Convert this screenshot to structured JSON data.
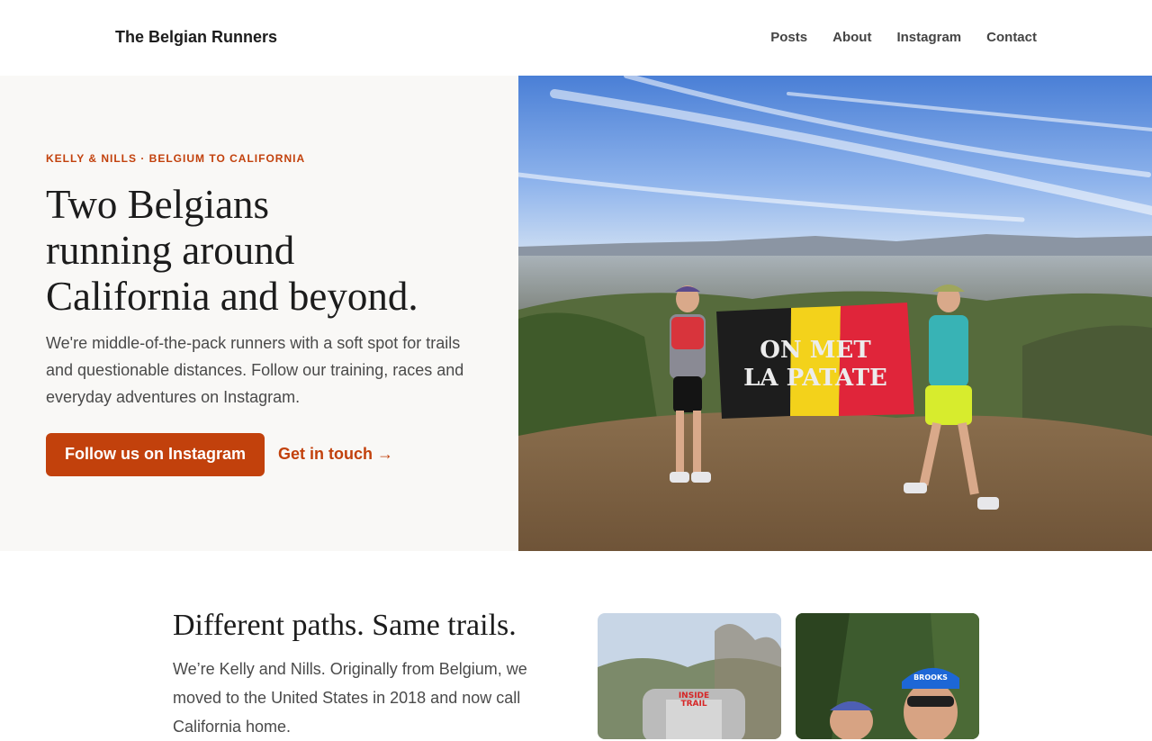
{
  "header": {
    "brand": "The Belgian Runners",
    "nav": [
      "Posts",
      "About",
      "Instagram",
      "Contact"
    ]
  },
  "hero": {
    "eyebrow": "KELLY & NILLS · BELGIUM TO CALIFORNIA",
    "title_lines": [
      "Two Belgians",
      "running around",
      "California and beyond."
    ],
    "text": "We're middle-of-the-pack runners with a soft spot for trails and questionable distances. Follow our training, races and everyday adventures on Instagram.",
    "primary_button": "Follow us on Instagram",
    "secondary_link": "Get in touch →",
    "flag_text": [
      "ON MET",
      "LA PATATE"
    ]
  },
  "about": {
    "title": "Different paths. Same trails.",
    "text": "We’re Kelly and Nills. Originally from Belgium, we moved to the United States in 2018 and now call California home."
  },
  "thumbs": {
    "banner_text": [
      "INSIDE",
      "TRAIL"
    ],
    "cap_text": "BROOKS"
  },
  "colors": {
    "accent": "#c2410c",
    "hero_bg": "#f9f8f6",
    "flag_black": "#1d1d1d",
    "flag_yellow": "#f3d21b",
    "flag_red": "#e0253a"
  }
}
